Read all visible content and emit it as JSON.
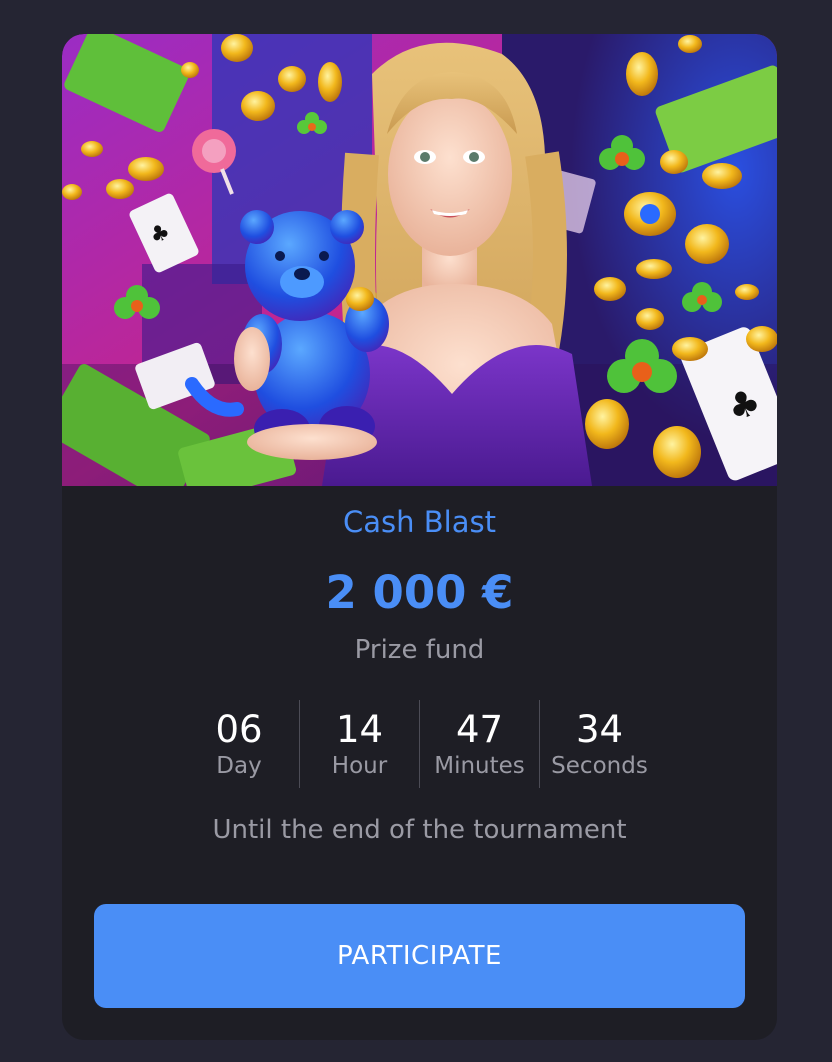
{
  "tournament": {
    "title": "Cash Blast",
    "prize_amount": "2 000 €",
    "prize_caption": "Prize fund",
    "countdown": [
      {
        "value": "06",
        "unit": "Day"
      },
      {
        "value": "14",
        "unit": "Hour"
      },
      {
        "value": "47",
        "unit": "Minutes"
      },
      {
        "value": "34",
        "unit": "Seconds"
      }
    ],
    "countdown_caption": "Until the end of the tournament",
    "participate_label": "PARTICIPATE"
  },
  "banner": {
    "description_icons": [
      "gummy-bear-icon",
      "gold-coin-icon",
      "playing-card-icon",
      "clover-icon",
      "banknote-icon"
    ]
  },
  "colors": {
    "accent": "#4a8ef6",
    "card_bg": "#1e1e25",
    "page_bg": "#252533",
    "muted_text": "#9a9aa4"
  }
}
